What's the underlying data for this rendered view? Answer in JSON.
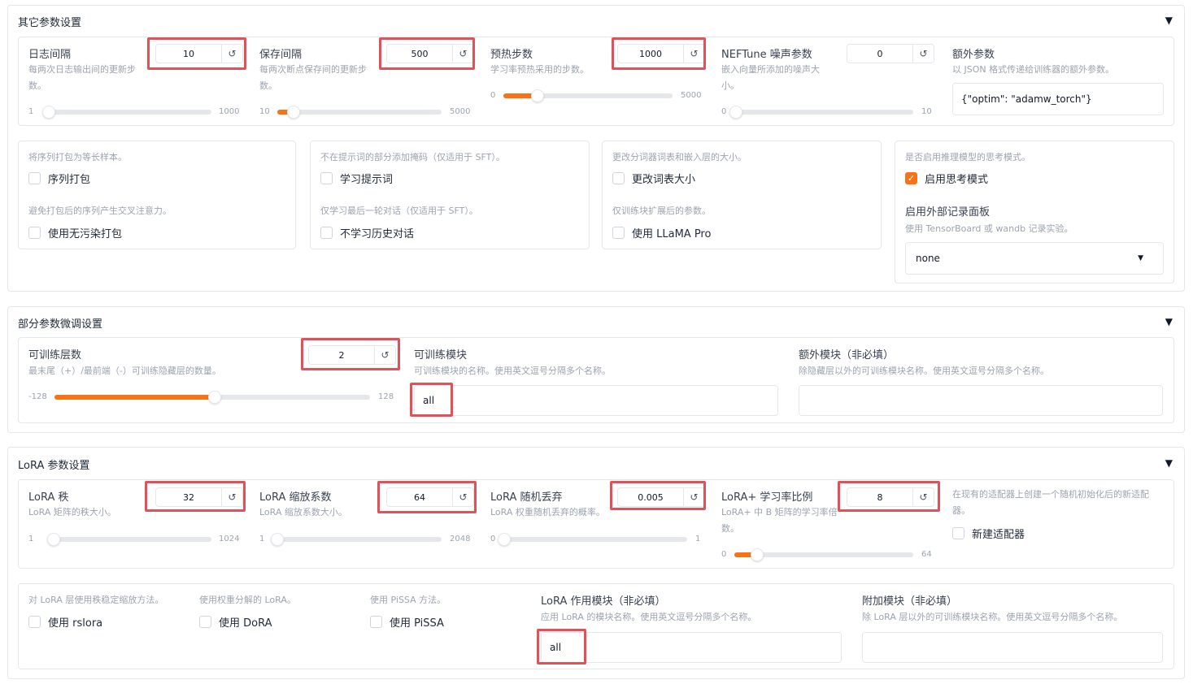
{
  "collapse_icon": "▼",
  "reset_icon": "↺",
  "check_icon": "✓",
  "caret_icon": "▼",
  "colors": {
    "accent": "#f97316",
    "highlight": "#e0525a"
  },
  "other": {
    "title": "其它参数设置",
    "logging_steps": {
      "label": "日志间隔",
      "desc": "每两次日志输出间的更新步数。",
      "value": "10",
      "min": "1",
      "max": "1000",
      "fraction": 0.0
    },
    "save_steps": {
      "label": "保存间隔",
      "desc": "每两次断点保存间的更新步数。",
      "value": "500",
      "min": "10",
      "max": "5000",
      "fraction": 0.1
    },
    "warmup_steps": {
      "label": "预热步数",
      "desc": "学习率预热采用的步数。",
      "value": "1000",
      "min": "0",
      "max": "5000",
      "fraction": 0.2
    },
    "neftune": {
      "label": "NEFTune 噪声参数",
      "desc": "嵌入向量所添加的噪声大小。",
      "value": "0",
      "min": "0",
      "max": "10",
      "fraction": 0.0
    },
    "extra_args": {
      "label": "额外参数",
      "desc": "以 JSON 格式传递给训练器的额外参数。",
      "value": "{\"optim\": \"adamw_torch\"}"
    },
    "packing": {
      "desc": "将序列打包为等长样本。",
      "label": "序列打包"
    },
    "neat_packing": {
      "desc": "避免打包后的序列产生交叉注意力。",
      "label": "使用无污染打包"
    },
    "train_on_prompt": {
      "desc": "不在提示词的部分添加掩码（仅适用于 SFT）。",
      "label": "学习提示词"
    },
    "mask_history": {
      "desc": "仅学习最后一轮对话（仅适用于 SFT）。",
      "label": "不学习历史对话"
    },
    "resize_vocab": {
      "desc": "更改分词器词表和嵌入层的大小。",
      "label": "更改词表大小"
    },
    "use_llama_pro": {
      "desc": "仅训练块扩展后的参数。",
      "label": "使用 LLaMA Pro"
    },
    "enable_thinking": {
      "desc": "是否启用推理模型的思考模式。",
      "label": "启用思考模式",
      "checked": true
    },
    "report_to": {
      "label": "启用外部记录面板",
      "desc": "使用 TensorBoard 或 wandb 记录实验。",
      "value": "none"
    }
  },
  "freeze": {
    "title": "部分参数微调设置",
    "trainable_layers": {
      "label": "可训练层数",
      "desc": "最末尾（+）/最前端（-）可训练隐藏层的数量。",
      "value": "2",
      "min": "-128",
      "max": "128",
      "fraction": 0.508
    },
    "trainable_modules": {
      "label": "可训练模块",
      "desc": "可训练模块的名称。使用英文逗号分隔多个名称。",
      "value": "all"
    },
    "extra_modules": {
      "label": "额外模块（非必填）",
      "desc": "除隐藏层以外的可训练模块名称。使用英文逗号分隔多个名称。",
      "value": ""
    }
  },
  "lora": {
    "title": "LoRA 参数设置",
    "rank": {
      "label": "LoRA 秩",
      "desc": "LoRA 矩阵的秩大小。",
      "value": "32",
      "min": "1",
      "max": "1024",
      "fraction": 0.03
    },
    "alpha": {
      "label": "LoRA 缩放系数",
      "desc": "LoRA 缩放系数大小。",
      "value": "64",
      "min": "1",
      "max": "2048",
      "fraction": 0.03
    },
    "dropout": {
      "label": "LoRA 随机丢弃",
      "desc": "LoRA 权重随机丢弃的概率。",
      "value": "0.005",
      "min": "0",
      "max": "1",
      "fraction": 0.005
    },
    "loraplus_ratio": {
      "label": "LoRA+ 学习率比例",
      "desc": "LoRA+ 中 B 矩阵的学习率倍数。",
      "value": "8",
      "min": "0",
      "max": "64",
      "fraction": 0.125
    },
    "create_new_adapter": {
      "desc": "在现有的适配器上创建一个随机初始化后的新适配器。",
      "label": "新建适配器"
    },
    "use_rslora": {
      "desc": "对 LoRA 层使用秩稳定缩放方法。",
      "label": "使用 rslora"
    },
    "use_dora": {
      "desc": "使用权重分解的 LoRA。",
      "label": "使用 DoRA"
    },
    "use_pissa": {
      "desc": "使用 PiSSA 方法。",
      "label": "使用 PiSSA"
    },
    "target_modules": {
      "label": "LoRA 作用模块（非必填）",
      "desc": "应用 LoRA 的模块名称。使用英文逗号分隔多个名称。",
      "value": "all"
    },
    "additional_target": {
      "label": "附加模块（非必填）",
      "desc": "除 LoRA 层以外的可训练模块名称。使用英文逗号分隔多个名称。",
      "value": ""
    }
  }
}
